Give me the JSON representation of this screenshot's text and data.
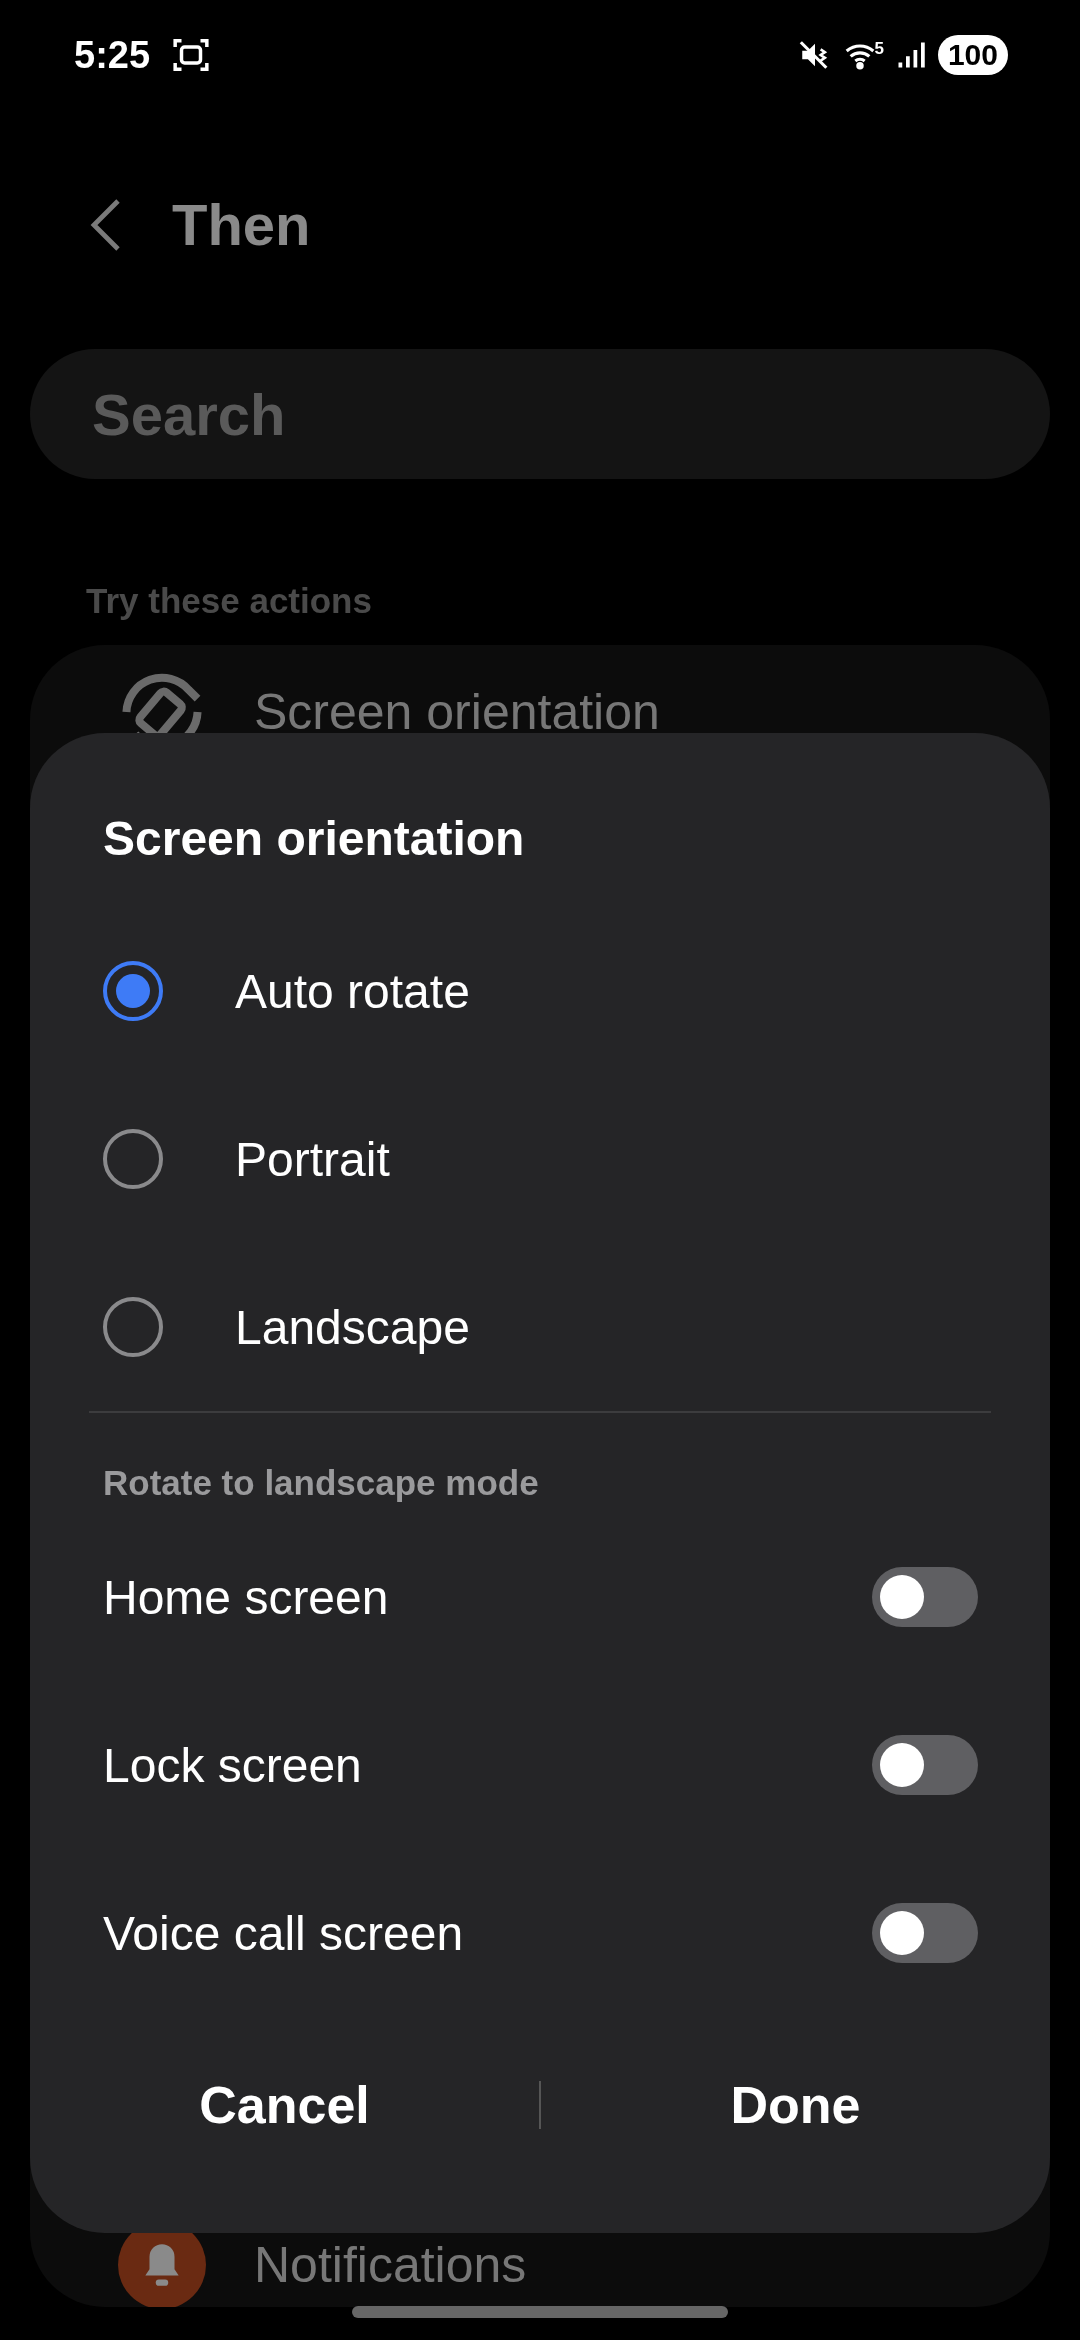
{
  "status_bar": {
    "time": "5:25",
    "wifi_label": "5",
    "battery": "100"
  },
  "header": {
    "title": "Then"
  },
  "search": {
    "placeholder": "Search"
  },
  "section": {
    "title": "Try these actions"
  },
  "actions": [
    {
      "label": "Screen orientation",
      "kind": "rotate"
    },
    {
      "label": "Notifications",
      "kind": "bell"
    }
  ],
  "dialog": {
    "title": "Screen orientation",
    "options": [
      {
        "label": "Auto rotate",
        "selected": true
      },
      {
        "label": "Portrait",
        "selected": false
      },
      {
        "label": "Landscape",
        "selected": false
      }
    ],
    "subheader": "Rotate to landscape mode",
    "toggles": [
      {
        "label": "Home screen",
        "on": false
      },
      {
        "label": "Lock screen",
        "on": false
      },
      {
        "label": "Voice call screen",
        "on": false
      }
    ],
    "buttons": [
      {
        "label": "Cancel"
      },
      {
        "label": "Done"
      }
    ]
  }
}
